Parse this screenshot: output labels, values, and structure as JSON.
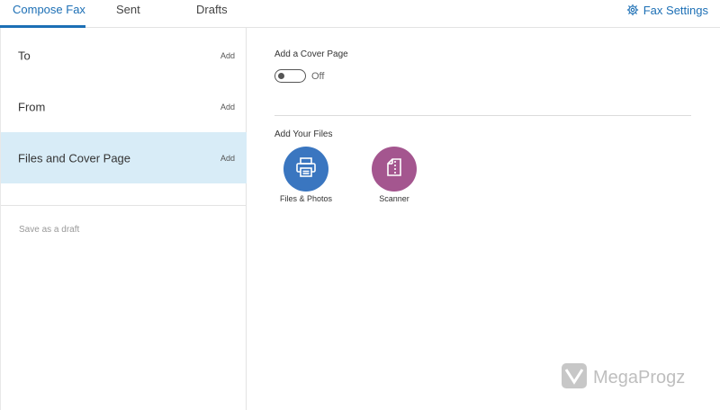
{
  "tabs": [
    {
      "label": "Compose Fax"
    },
    {
      "label": "Sent"
    },
    {
      "label": "Drafts"
    }
  ],
  "settings": {
    "label": "Fax Settings",
    "icon": "gear-icon"
  },
  "sections": [
    {
      "label": "To",
      "action": "Add"
    },
    {
      "label": "From",
      "action": "Add"
    },
    {
      "label": "Files and Cover Page",
      "action": "Add"
    }
  ],
  "draft": {
    "label": "Save as a draft"
  },
  "cover_page": {
    "heading": "Add a Cover Page",
    "toggle_state": "Off"
  },
  "files": {
    "heading": "Add Your Files",
    "sources": [
      {
        "label": "Files & Photos",
        "icon": "printer-icon"
      },
      {
        "label": "Scanner",
        "icon": "scanner-icon"
      }
    ]
  },
  "watermark": {
    "text": "MegaProgz"
  },
  "colors": {
    "accent": "#1c6fb5",
    "selected_row": "#d8ecf7",
    "files_circle": "#3a76c0",
    "scanner_circle": "#a4568f"
  }
}
